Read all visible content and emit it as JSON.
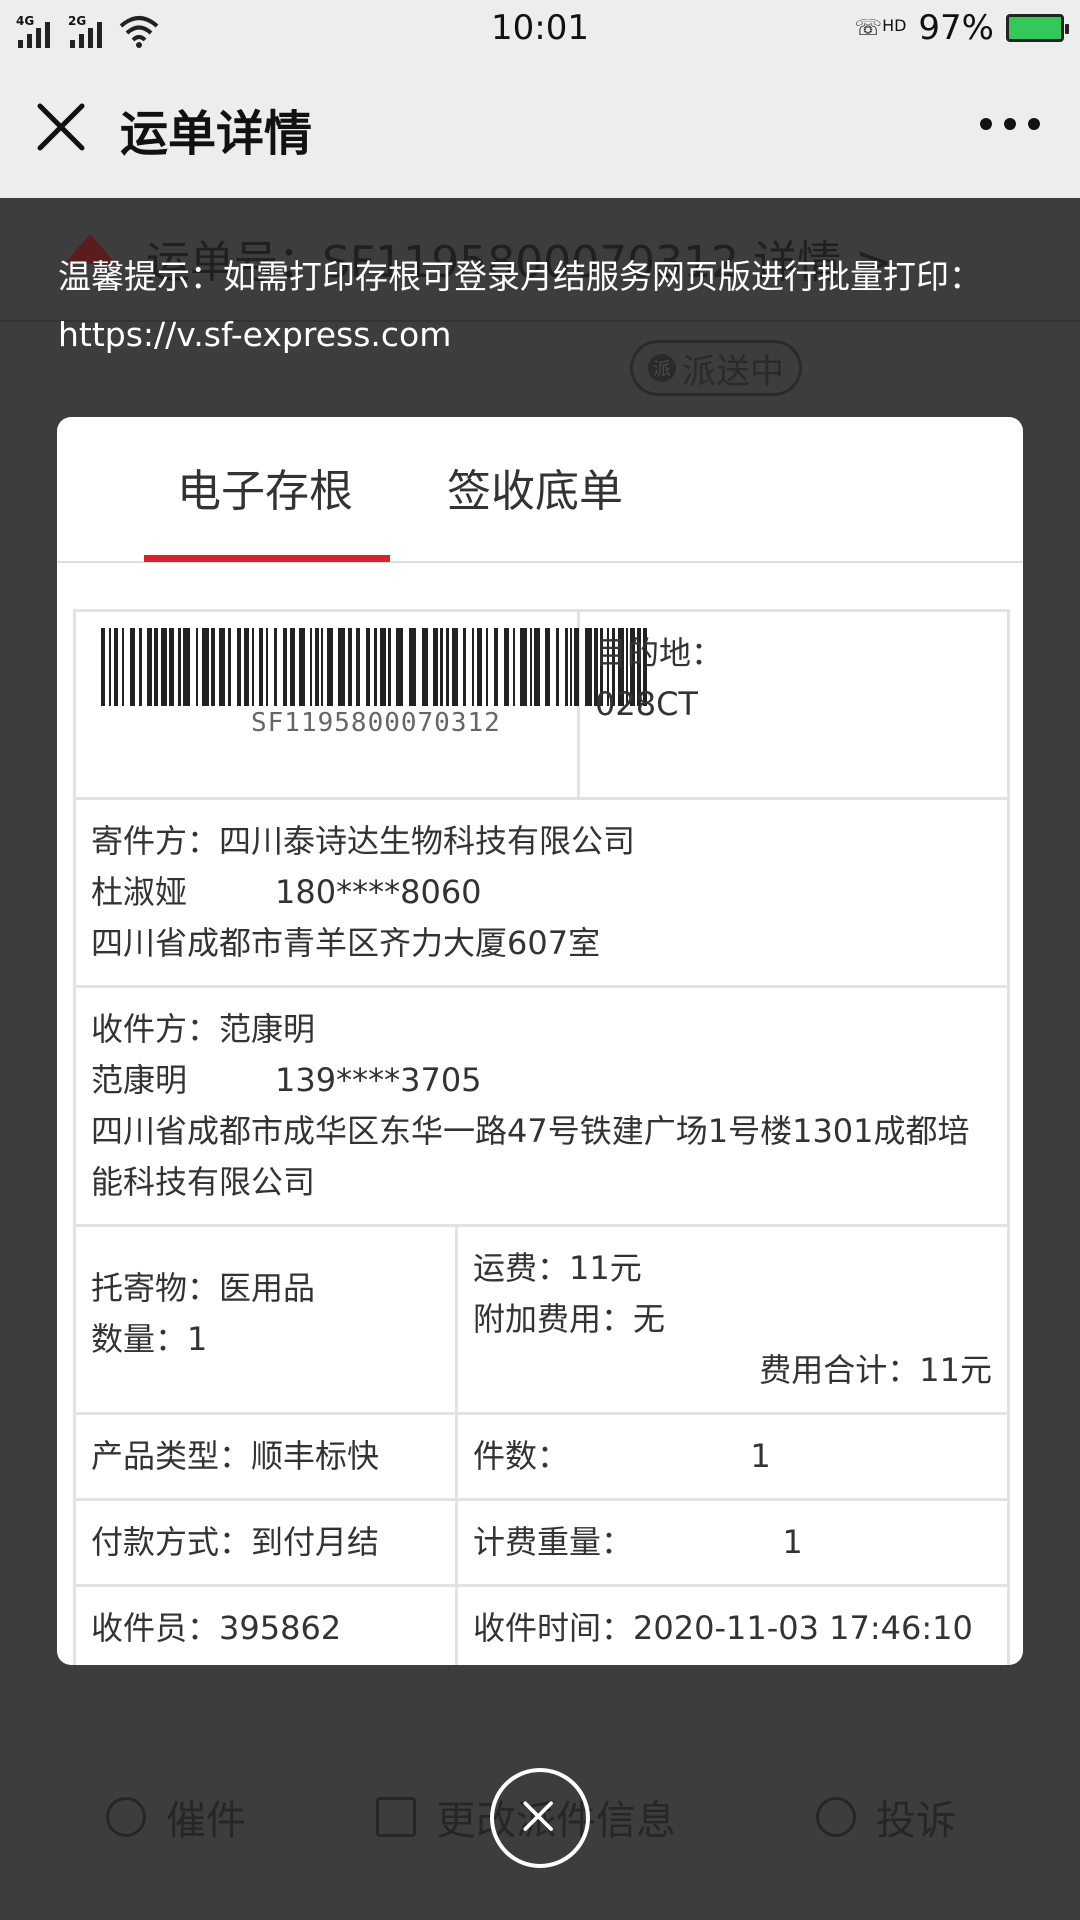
{
  "status_bar": {
    "network_1": "4G",
    "network_2": "2G",
    "time": "10:01",
    "call_badge": "HD",
    "battery": "97%",
    "battery_color": "#34c759"
  },
  "nav": {
    "title": "运单详情",
    "close_icon": "close-icon",
    "more_icon": "more-icon"
  },
  "background": {
    "waybill_label": "运单号：SF1195800070312 详情 >",
    "status_badge_icon": "派",
    "status_badge": "派送中",
    "actions": [
      {
        "label": "催件",
        "icon": "timer-icon"
      },
      {
        "label": "更改派件信息",
        "icon": "edit-icon"
      },
      {
        "label": "投诉",
        "icon": "alert-icon"
      }
    ]
  },
  "tip": "温馨提示：如需打印存根可登录月结服务网页版进行批量打印：https://v.sf-express.com",
  "modal": {
    "tabs": [
      "电子存根",
      "签收底单"
    ],
    "active_tab": 0,
    "accent_color": "#d8202f",
    "barcode_number": "SF1195800070312",
    "destination_label": "目的地：",
    "destination_code": "028CT",
    "sender": {
      "line1": "寄件方：四川泰诗达生物科技有限公司",
      "name": "杜淑娅",
      "phone": "180****8060",
      "address": "四川省成都市青羊区齐力大厦607室"
    },
    "receiver": {
      "line1": "收件方：范康明",
      "name": "范康明",
      "phone": "139****3705",
      "address": "四川省成都市成华区东华一路47号铁建广场1号楼1301成都培能科技有限公司"
    },
    "goods": {
      "item": "托寄物：医用品",
      "quantity": "数量：1"
    },
    "fees": {
      "freight": "运费：11元",
      "extra": "附加费用：无",
      "total": "费用合计：11元"
    },
    "product_type": "产品类型：顺丰标快",
    "pieces_label": "件数：",
    "pieces_value": "1",
    "payment": "付款方式：到付月结",
    "weight_label": "计费重量：",
    "weight_value": "1",
    "courier": "收件员：395862",
    "pickup_time": "收件时间：2020-11-03 17:46:10"
  },
  "close_overlay_icon": "close-circle-icon"
}
